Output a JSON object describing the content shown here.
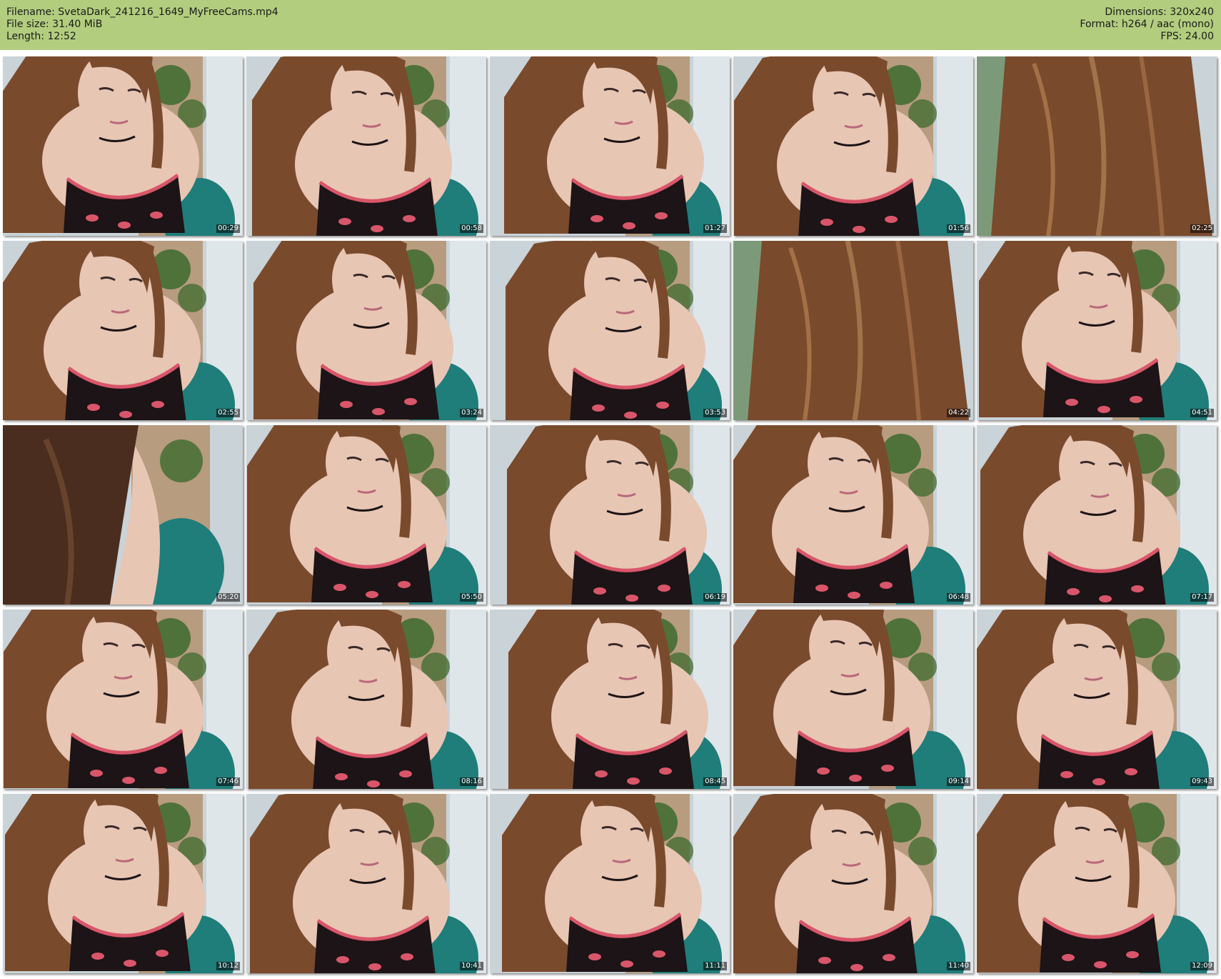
{
  "info": {
    "filename": "Filename: SvetaDark_241216_1649_MyFreeCams.mp4",
    "filesize": "File size: 31.40 MiB",
    "length": "Length: 12:52",
    "dimensions": "Dimensions: 320x240",
    "format": "Format: h264 / aac (mono)",
    "fps": "FPS: 24.00"
  },
  "thumbnails": [
    {
      "time": "00:29",
      "scene": "face"
    },
    {
      "time": "00:58",
      "scene": "face"
    },
    {
      "time": "01:27",
      "scene": "face"
    },
    {
      "time": "01:56",
      "scene": "face"
    },
    {
      "time": "02:25",
      "scene": "hair"
    },
    {
      "time": "02:55",
      "scene": "face"
    },
    {
      "time": "03:24",
      "scene": "face"
    },
    {
      "time": "03:53",
      "scene": "face"
    },
    {
      "time": "04:22",
      "scene": "hair"
    },
    {
      "time": "04:51",
      "scene": "face"
    },
    {
      "time": "05:20",
      "scene": "hair-side"
    },
    {
      "time": "05:50",
      "scene": "face"
    },
    {
      "time": "06:19",
      "scene": "face"
    },
    {
      "time": "06:48",
      "scene": "face"
    },
    {
      "time": "07:17",
      "scene": "face"
    },
    {
      "time": "07:46",
      "scene": "face"
    },
    {
      "time": "08:16",
      "scene": "face"
    },
    {
      "time": "08:45",
      "scene": "face"
    },
    {
      "time": "09:14",
      "scene": "face"
    },
    {
      "time": "09:43",
      "scene": "face"
    },
    {
      "time": "10:12",
      "scene": "face"
    },
    {
      "time": "10:41",
      "scene": "face"
    },
    {
      "time": "11:11",
      "scene": "face"
    },
    {
      "time": "11:40",
      "scene": "face"
    },
    {
      "time": "12:09",
      "scene": "face"
    }
  ],
  "colors": {
    "header_bg": "#b2cd7e",
    "wall": "#c9d3d8",
    "curtain": "#b08a62",
    "plant": "#3d6b2e",
    "skin": "#e8c6b4",
    "hair": "#7a4a2c",
    "top": "#1c1416",
    "lace": "#d9566a",
    "chair": "#1f7d7a"
  }
}
